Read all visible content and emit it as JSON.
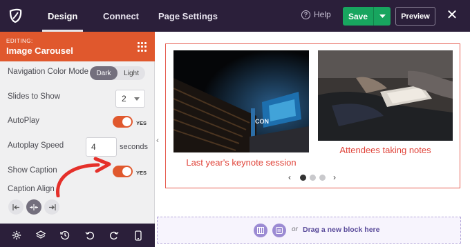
{
  "topbar": {
    "tabs": [
      {
        "label": "Design"
      },
      {
        "label": "Connect"
      },
      {
        "label": "Page Settings"
      }
    ],
    "help_label": "Help",
    "help_glyph": "?",
    "save_label": "Save",
    "preview_label": "Preview",
    "close_glyph": "✕"
  },
  "sidebar": {
    "editing_prefix": "EDITING:",
    "block_title": "Image Carousel",
    "nav_color_mode": {
      "label": "Navigation Color Mode",
      "options": [
        "Dark",
        "Light"
      ],
      "selected": "Dark"
    },
    "slides_to_show": {
      "label": "Slides to Show",
      "value": "2"
    },
    "autoplay": {
      "label": "AutoPlay",
      "state": "YES"
    },
    "autoplay_speed": {
      "label": "Autoplay Speed",
      "value": "4",
      "unit": "seconds"
    },
    "show_caption": {
      "label": "Show Caption",
      "state": "YES"
    },
    "caption_align": {
      "label": "Caption Align",
      "selected": "center"
    },
    "collapse_glyph": "‹"
  },
  "carousel": {
    "slides": [
      {
        "caption": "Last year's keynote session"
      },
      {
        "caption": "Attendees taking notes"
      }
    ],
    "dots": 3,
    "active_dot": 0,
    "prev_glyph": "‹",
    "next_glyph": "›"
  },
  "dropzone": {
    "or_label": "or",
    "text": "Drag a new block here"
  },
  "colors": {
    "accent": "#e0582d",
    "topbar": "#2b1f3a",
    "save": "#18a55f",
    "caption": "#e0443a"
  }
}
